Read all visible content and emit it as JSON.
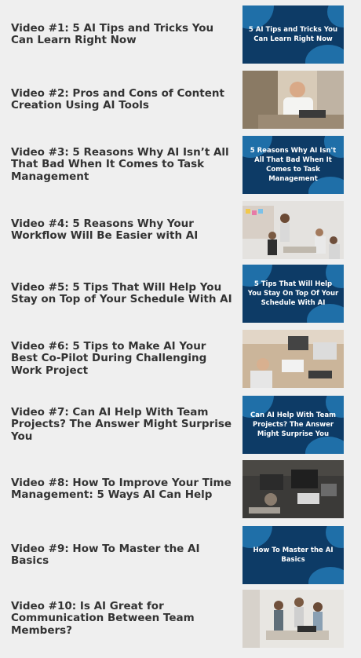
{
  "videos": [
    {
      "title": "Video #1: 5 AI Tips and Tricks You Can Learn Right Now",
      "thumb": {
        "kind": "graphic",
        "caption": "5 AI Tips and Tricks You Can Learn Right Now"
      }
    },
    {
      "title": "Video #2: Pros and Cons of Content Creation Using AI Tools",
      "thumb": {
        "kind": "photo",
        "icon": "man-at-laptop-photo"
      }
    },
    {
      "title": "Video #3: 5 Reasons Why AI Isn’t All That Bad When It Comes to Task Management",
      "thumb": {
        "kind": "graphic",
        "caption": "5 Reasons Why AI Isn't All That Bad When It Comes to Task Management"
      }
    },
    {
      "title": "Video #4: 5 Reasons Why Your Workflow Will Be Easier with AI",
      "thumb": {
        "kind": "photo",
        "icon": "team-meeting-photo"
      }
    },
    {
      "title": "Video #5: 5 Tips That Will Help You Stay on Top of Your Schedule With AI",
      "thumb": {
        "kind": "graphic",
        "caption": "5 Tips That Will Help You Stay On Top Of Your Schedule With AI"
      }
    },
    {
      "title": "Video #6: 5 Tips to Make AI Your Best Co-Pilot During Challenging Work Project",
      "thumb": {
        "kind": "photo",
        "icon": "desk-work-photo"
      }
    },
    {
      "title": "Video #7: Can AI Help With Team Projects? The Answer Might Surprise You",
      "thumb": {
        "kind": "graphic",
        "caption": "Can AI Help With Team Projects? The Answer Might Surprise You"
      }
    },
    {
      "title": "Video #8: How To Improve Your Time Management: 5 Ways AI Can Help",
      "thumb": {
        "kind": "photo",
        "icon": "workspace-desk-photo"
      }
    },
    {
      "title": "Video #9: How To Master the AI Basics",
      "thumb": {
        "kind": "graphic",
        "caption": "How To Master the AI Basics"
      }
    },
    {
      "title": "Video #10: Is AI Great for Communication Between Team Members?",
      "thumb": {
        "kind": "photo",
        "icon": "team-office-photo"
      }
    }
  ],
  "colors": {
    "background": "#efefef",
    "title_text": "#333333",
    "graphic_bg": "#0d3b66",
    "graphic_accent": "#1f6fa8"
  }
}
